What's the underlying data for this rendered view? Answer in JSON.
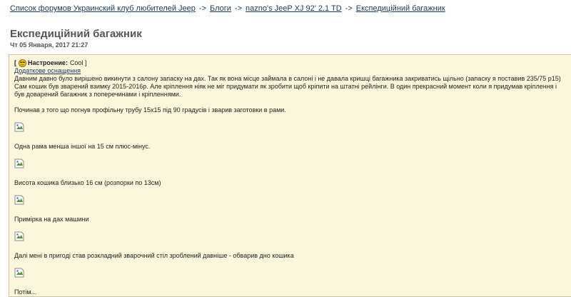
{
  "breadcrumb": {
    "items": [
      "Список форумов Украинский клуб любителей Jeep",
      "Блоги",
      "nazno's JeeP XJ 92' 2.1 TD",
      "Експедиційний багажник"
    ],
    "separator": "->"
  },
  "post": {
    "title": "Експедиційний багажник",
    "date": "Чт 05 Января, 2017 21:27",
    "mood_label": "[ ",
    "mood_prefix": "Настроение:",
    "mood_value": "Cool ]",
    "tag": "Додаткове оснащення",
    "paragraphs": [
      "Давним давно було вирішено викинути з салону запаску на дах. Так як вона місце займала в салоні і не давала кришці багажника закриватись щільно (запаску я поставив 235/75 p15)",
      "Сам кошик був зварений взимку 2015-2016р. Але кріплення ніяк не міг придумати як зробити щоб кріпити на штатні рейлінги. В один прекрасний момент коли я придумав кріплення і був доварений багажник з поперечинами і кріпленнями.",
      "Починав з того що погнув профільну трубу 15х15 під 90 градусів і зварив заготовки в рами.",
      "Одна рама менша іншої на 15 см плюс-мінус.",
      "Висота кошика близько 16 см (розпорки по 13см)",
      "Примірка на дах машини",
      "Далі мені в пригоді став розкладний зварочний стіл зроблений давніше - обварив дно кошика",
      "Потім..."
    ]
  },
  "colors": {
    "link": "#1a3a5e",
    "post_bg": "#fbf6dc",
    "post_border": "#c9c4a8",
    "title": "#555555"
  }
}
